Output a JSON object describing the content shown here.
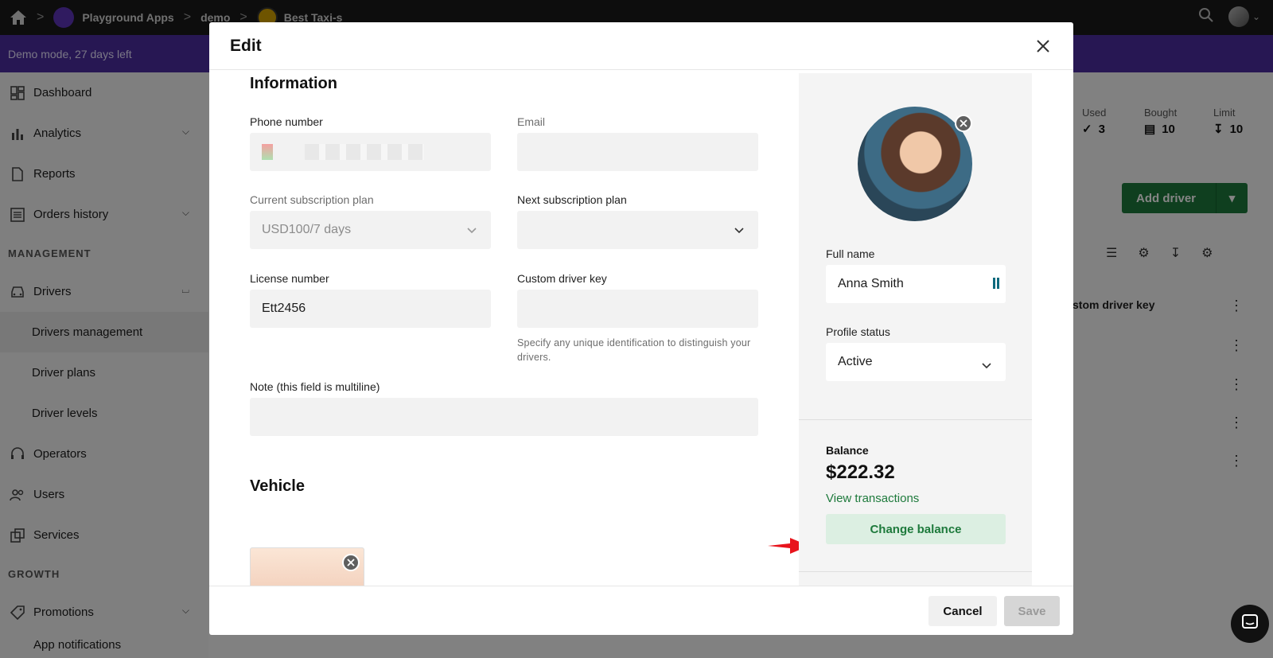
{
  "topbar": {
    "breadcrumbs": [
      "Playground Apps",
      "demo",
      "Best Taxi-s"
    ],
    "logo_text": "Best Taxi-s"
  },
  "banner": {
    "text": "Demo mode, 27 days left"
  },
  "sidebar": {
    "items": [
      {
        "label": "Dashboard",
        "icon": "dashboard-icon"
      },
      {
        "label": "Analytics",
        "icon": "bar-chart-icon",
        "expandable": true
      },
      {
        "label": "Reports",
        "icon": "document-icon"
      },
      {
        "label": "Orders history",
        "icon": "list-icon",
        "expandable": true
      }
    ],
    "section_management": "MANAGEMENT",
    "drivers": {
      "label": "Drivers",
      "icon": "car-icon",
      "subitems": [
        "Drivers management",
        "Driver plans",
        "Driver levels"
      ]
    },
    "items2": [
      {
        "label": "Operators",
        "icon": "headset-icon"
      },
      {
        "label": "Users",
        "icon": "users-icon"
      },
      {
        "label": "Services",
        "icon": "services-icon"
      }
    ],
    "section_growth": "GROWTH",
    "promotions": {
      "label": "Promotions",
      "icon": "tag-icon"
    },
    "cutoff_item": "App notifications"
  },
  "background": {
    "stats": [
      {
        "label": "Used",
        "value": "3"
      },
      {
        "label": "Bought",
        "value": "10"
      },
      {
        "label": "Limit",
        "value": "10"
      }
    ],
    "add_driver_label": "Add driver",
    "table_header_partial": "stom driver key"
  },
  "dialog": {
    "title": "Edit",
    "information_title": "Information",
    "phone_label": "Phone number",
    "email_label": "Email",
    "email_value": "",
    "current_plan_label": "Current subscription plan",
    "current_plan_value": "USD100/7 days",
    "next_plan_label": "Next subscription plan",
    "next_plan_value": "",
    "license_label": "License number",
    "license_value": "Ett2456",
    "custom_key_label": "Custom driver key",
    "custom_key_value": "",
    "custom_key_hint": "Specify any unique identification to distinguish your drivers.",
    "note_label": "Note (this field is multiline)",
    "note_value": "",
    "vehicle_title": "Vehicle",
    "full_name_label": "Full name",
    "full_name_value": "Anna Smith",
    "profile_status_label": "Profile status",
    "profile_status_value": "Active",
    "balance_label": "Balance",
    "balance_value": "$222.32",
    "view_transactions_label": "View transactions",
    "change_balance_label": "Change balance",
    "cancel_label": "Cancel",
    "save_label": "Save"
  },
  "colors": {
    "accent_green": "#1e7a3c",
    "banner_purple": "#4b2ca0",
    "annotation_arrow": "#e8141c"
  }
}
